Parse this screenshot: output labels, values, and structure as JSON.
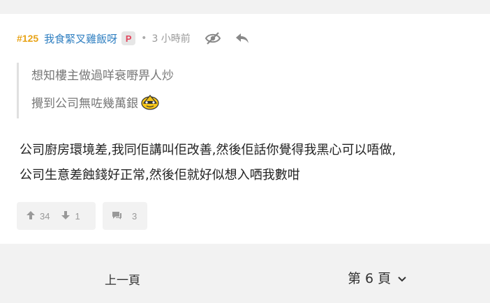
{
  "post": {
    "floor": "#125",
    "username": "我食緊叉雞飯呀",
    "badge": "P",
    "dot": "•",
    "time": "3 小時前",
    "icons": [
      "hide-eye-icon",
      "reply-icon"
    ]
  },
  "quote": {
    "line1": "想知樓主做過咩衰嘢畀人炒",
    "line2": "攪到公司無咗幾萬銀",
    "emoji": "emoji-face-icon"
  },
  "content": {
    "line1": "公司廚房環境差,我同佢講叫佢改善,然後佢話你覺得我黑心可以唔做,",
    "line2": "公司生意差蝕錢好正常,然後佢就好似想入哂我數咁"
  },
  "votes": {
    "up": "34",
    "down": "1",
    "comments": "3"
  },
  "pager": {
    "prev": "上一頁",
    "page_label": "第 6 頁"
  },
  "colors": {
    "floor": "#e8a317",
    "username": "#2f7fc1",
    "badge": "#e2445c",
    "background": "#f2f2f2"
  }
}
